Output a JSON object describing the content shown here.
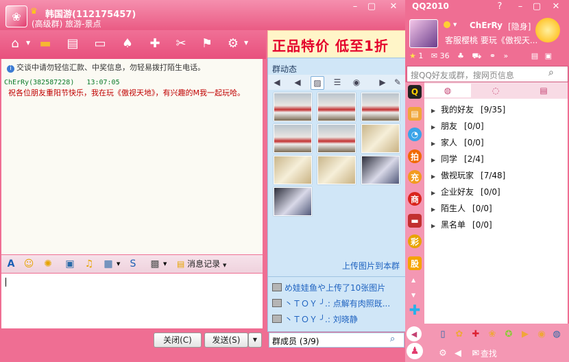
{
  "chat": {
    "group_name": "韩国游(112175457)",
    "group_sub": "(高级群) 旅游-景点",
    "ad_text": "正品特价 低至1折",
    "notice": "交谈中请勿轻信汇款、中奖信息，勿轻易拨打陌生电话。",
    "message": {
      "sender": "ChErRy(382587228)",
      "time": "13:07:05",
      "text": "祝各位朋友重阳节快乐，我在玩《傲视天地》，有兴趣的M我一起玩哈。"
    },
    "history_label": "消息记录",
    "close_label": "关闭(C)",
    "send_label": "发送(S)"
  },
  "group_panel": {
    "title": "群动态",
    "upload_link": "上传图片到本群",
    "feed": [
      "め娃娃鱼や上传了10张图片",
      "丶ＴＯＹ ╯.: 点解有肉照既...",
      "丶ＴＯＹ ╯.: 刘晓静"
    ],
    "members": "群成员 (3/9)"
  },
  "qq": {
    "title": "QQ2010",
    "nickname": "ChErRy",
    "status": "隐身",
    "signature": "客服樱桃 要玩《傲视天...",
    "counts": {
      "star": "1",
      "mail": "36"
    },
    "search_placeholder": "搜QQ好友或群，搜网页信息",
    "groups": [
      {
        "name": "我的好友",
        "count": "[9/35]"
      },
      {
        "name": "朋友",
        "count": "[0/0]"
      },
      {
        "name": "家人",
        "count": "[0/0]"
      },
      {
        "name": "同学",
        "count": "[2/4]"
      },
      {
        "name": "傲视玩家",
        "count": "[7/48]"
      },
      {
        "name": "企业好友",
        "count": "[0/0]"
      },
      {
        "name": "陌生人",
        "count": "[0/0]"
      },
      {
        "name": "黑名单",
        "count": "[0/0]"
      }
    ],
    "find_label": "查找"
  }
}
